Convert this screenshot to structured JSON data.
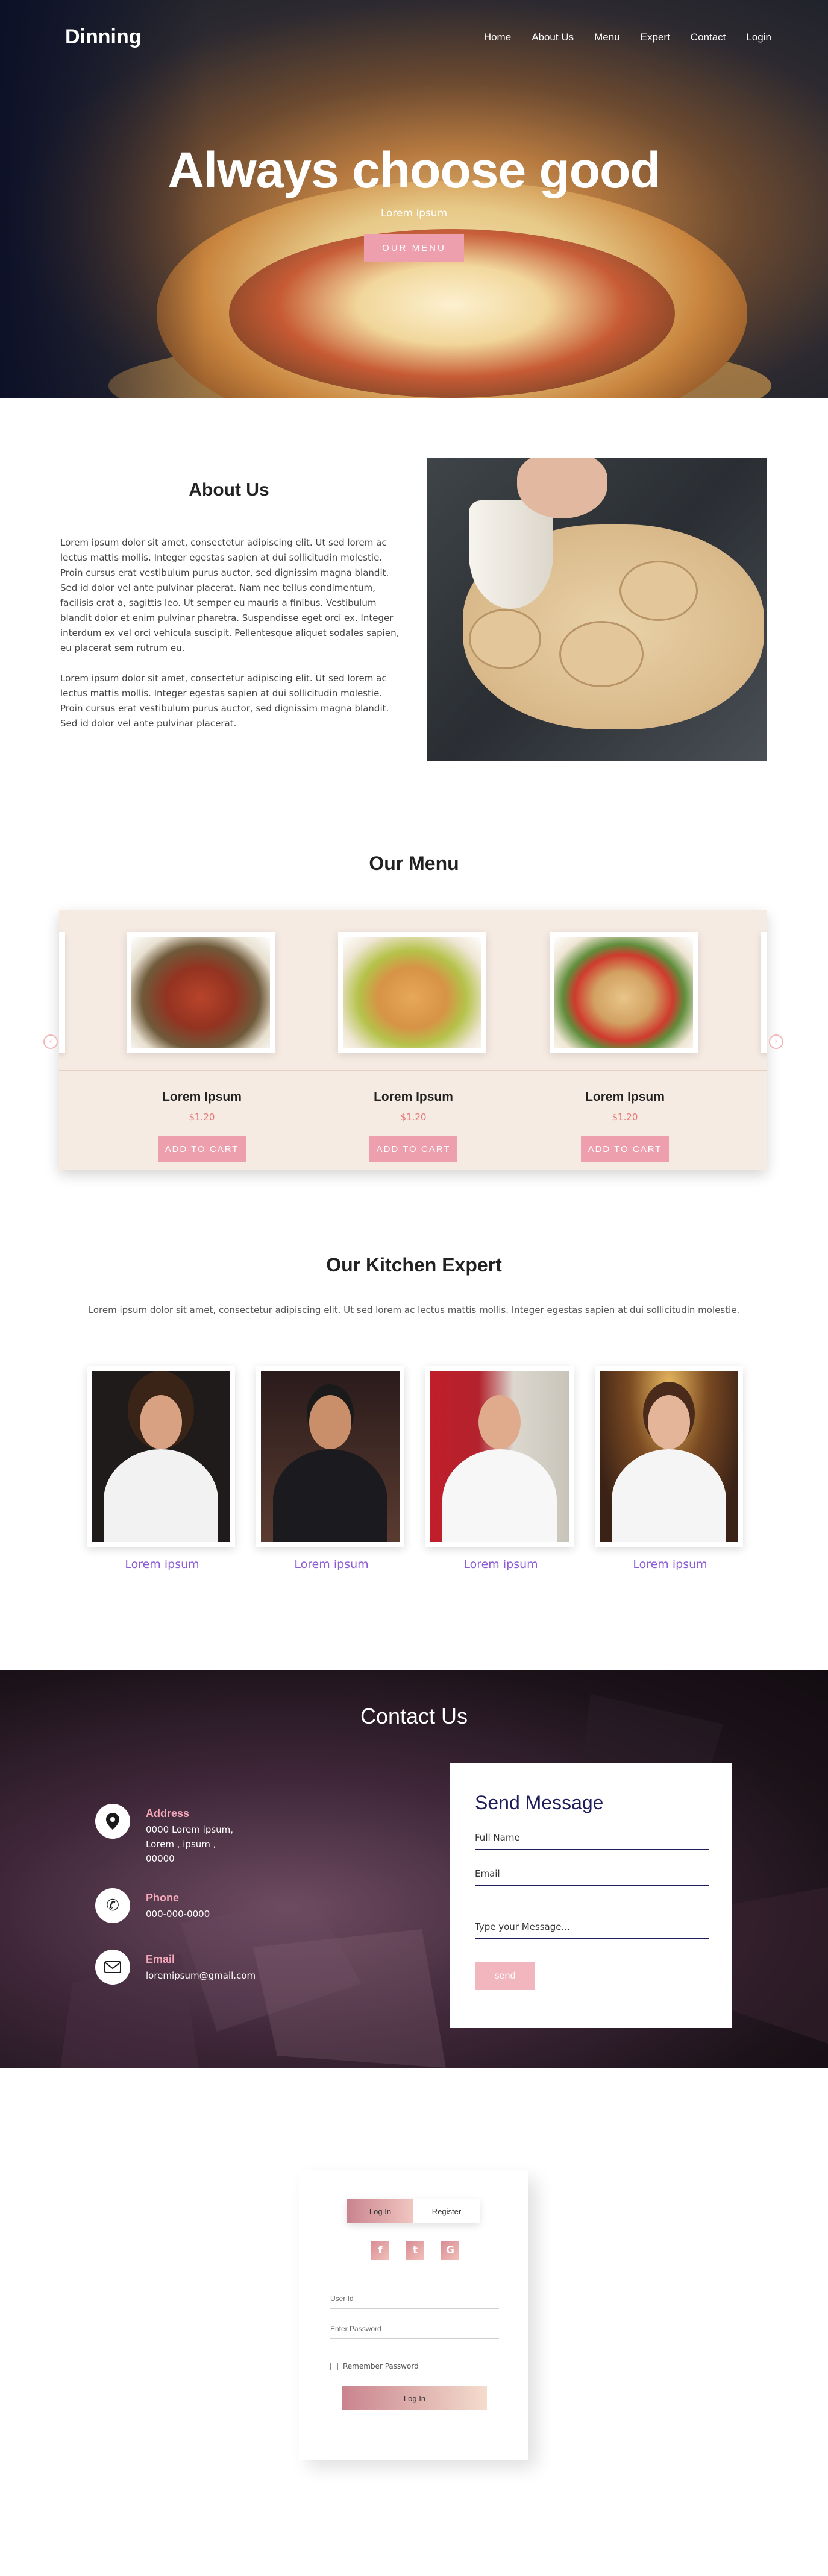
{
  "hero": {
    "logo": "Dinning",
    "nav": [
      "Home",
      "About Us",
      "Menu",
      "Expert",
      "Contact",
      "Login"
    ],
    "headline": "Always choose good",
    "subtitle": "Lorem ipsum",
    "cta": "OUR MENU"
  },
  "about": {
    "title": "About Us",
    "paragraphs": [
      "Lorem ipsum dolor sit amet, consectetur adipiscing elit. Ut sed lorem ac lectus mattis mollis. Integer egestas sapien at dui sollicitudin molestie. Proin cursus erat vestibulum purus auctor, sed dignissim magna blandit. Sed id dolor vel ante pulvinar placerat. Nam nec tellus condimentum, facilisis erat a, sagittis leo. Ut semper eu mauris a finibus. Vestibulum blandit dolor et enim pulvinar pharetra. Suspendisse eget orci ex. Integer interdum ex vel orci vehicula suscipit. Pellentesque aliquet sodales sapien, eu placerat sem rutrum eu.",
      "Lorem ipsum dolor sit amet, consectetur adipiscing elit. Ut sed lorem ac lectus mattis mollis. Integer egestas sapien at dui sollicitudin molestie. Proin cursus erat vestibulum purus auctor, sed dignissim magna blandit. Sed id dolor vel ante pulvinar placerat."
    ]
  },
  "menu": {
    "title": "Our Menu",
    "items": [
      {
        "name": "Lorem Ipsum",
        "price": "$1.20",
        "button": "ADD TO CART"
      },
      {
        "name": "Lorem Ipsum",
        "price": "$1.20",
        "button": "ADD TO CART"
      },
      {
        "name": "Lorem Ipsum",
        "price": "$1.20",
        "button": "ADD TO CART"
      }
    ]
  },
  "experts": {
    "title": "Our Kitchen Expert",
    "description": "Lorem ipsum dolor sit amet, consectetur adipiscing elit. Ut sed lorem ac lectus mattis mollis. Integer egestas sapien at dui sollicitudin molestie.",
    "people": [
      {
        "label": "Lorem ipsum"
      },
      {
        "label": "Lorem ipsum"
      },
      {
        "label": "Lorem ipsum"
      },
      {
        "label": "Lorem ipsum"
      }
    ]
  },
  "contact": {
    "title": "Contact Us",
    "address_label": "Address",
    "address_value": "0000 Lorem ipsum,\nLorem , ipsum ,\n00000",
    "phone_label": "Phone",
    "phone_value": "000-000-0000",
    "email_label": "Email",
    "email_value": "loremipsum@gmail.com",
    "form": {
      "title": "Send Message",
      "name_placeholder": "Full Name",
      "email_placeholder": "Email",
      "message_placeholder": "Type your Message...",
      "send": "send"
    }
  },
  "login": {
    "tab_login": "Log In",
    "tab_register": "Register",
    "social": [
      "f",
      "t",
      "G"
    ],
    "user_placeholder": "User Id",
    "password_placeholder": "Enter Password",
    "remember": "Remember Password",
    "button": "Log In"
  },
  "colors": {
    "accent_pink": "#ee9fae",
    "price_red": "#e47474",
    "expert_purple": "#8b5cd6",
    "form_navy": "#1e1f5a",
    "contact_label": "#f4a7b9"
  }
}
